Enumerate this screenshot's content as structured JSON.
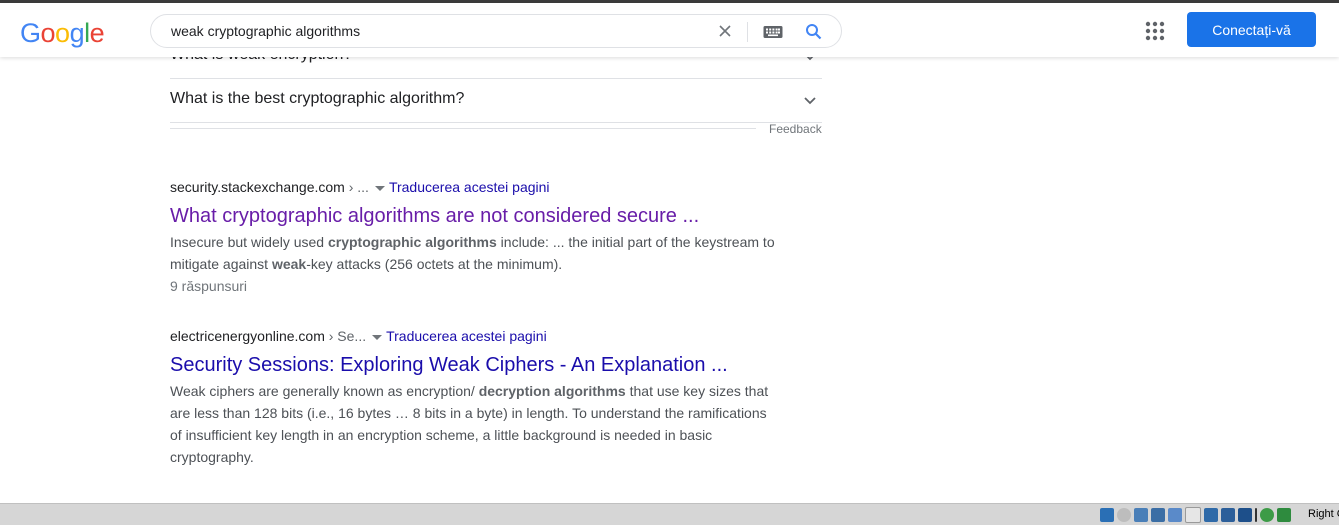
{
  "search": {
    "query": "weak cryptographic algorithms"
  },
  "header": {
    "logo_letters": [
      "G",
      "o",
      "o",
      "g",
      "l",
      "e"
    ],
    "signin_label": "Conectați-vă",
    "colors": {
      "signin_bg": "#1a73e8"
    }
  },
  "faq": {
    "items": [
      {
        "question": "What is weak encryption?"
      },
      {
        "question": "What is the best cryptographic algorithm?"
      }
    ],
    "feedback_label": "Feedback"
  },
  "results": [
    {
      "domain": "security.stackexchange.com",
      "path": "› ...",
      "translate_label": "Traducerea acestei pagini",
      "title": "What cryptographic algorithms are not considered secure ...",
      "snippet_parts": [
        {
          "text": "Insecure but widely used ",
          "bold": false
        },
        {
          "text": "cryptographic algorithms",
          "bold": true
        },
        {
          "text": " include: ... the initial part of the keystream to mitigate against ",
          "bold": false
        },
        {
          "text": "weak",
          "bold": true
        },
        {
          "text": "-key attacks (256 octets at the minimum).",
          "bold": false
        }
      ],
      "meta": "9 răspunsuri",
      "visited": true
    },
    {
      "domain": "electricenergyonline.com",
      "path": "› Se...",
      "translate_label": "Traducerea acestei pagini",
      "title": "Security Sessions: Exploring Weak Ciphers - An Explanation ...",
      "snippet_parts": [
        {
          "text": "Weak ciphers are generally known as encryption/ ",
          "bold": false
        },
        {
          "text": "decryption algorithms",
          "bold": true
        },
        {
          "text": " that use key sizes that are less than 128 bits (i.e., 16 bytes … 8 bits in a byte) in length. To understand the ramifications of insufficient key length in an encryption scheme, a little background is needed in basic cryptography.",
          "bold": false
        }
      ],
      "meta": "",
      "visited": false
    }
  ],
  "statusbar": {
    "right_label": "Right C"
  }
}
